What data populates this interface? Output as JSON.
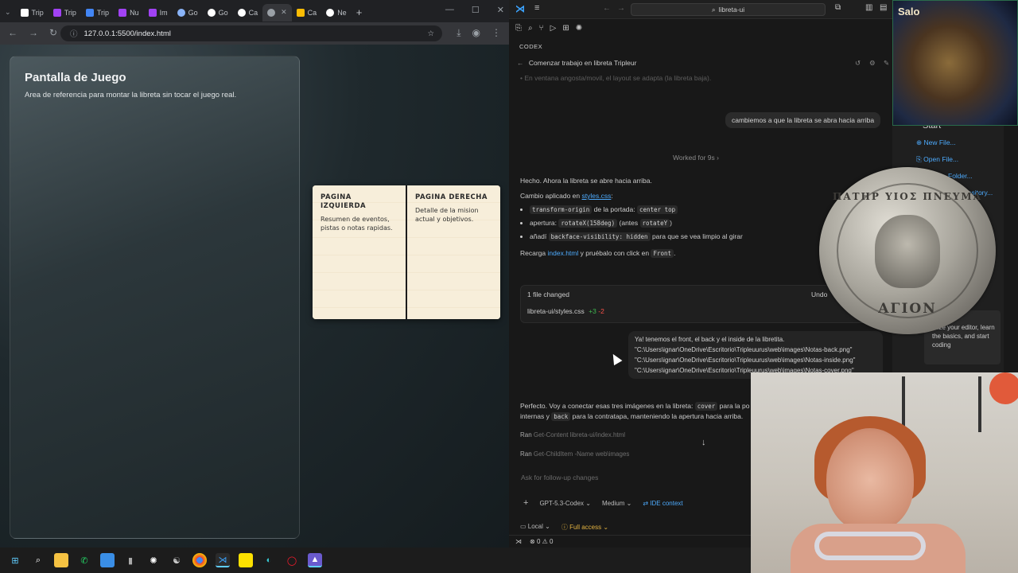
{
  "browser": {
    "tabs": [
      {
        "label": "Trip",
        "color": "#ffffff"
      },
      {
        "label": "Trip",
        "color": "#a142f4"
      },
      {
        "label": "Trip",
        "color": "#4285f4"
      },
      {
        "label": "Nu",
        "color": "#a142f4"
      },
      {
        "label": "Im",
        "color": "#a142f4"
      },
      {
        "label": "Go",
        "color": "#8ab4f8"
      },
      {
        "label": "Go",
        "color": "#ffffff"
      },
      {
        "label": "Ca",
        "color": "#ffffff"
      },
      {
        "label": "",
        "color": "#9aa0a6"
      },
      {
        "label": "Ca",
        "color": "#fbbc04"
      },
      {
        "label": "Ne",
        "color": "#ffffff"
      }
    ],
    "active_tab_index": 8,
    "url": "127.0.0.1:5500/index.html",
    "page": {
      "title": "Pantalla de Juego",
      "subtitle": "Area de referencia para montar la libreta sin tocar el juego real.",
      "left_page": {
        "heading": "PAGINA IZQUIERDA",
        "body": "Resumen de eventos, pistas o notas rapidas."
      },
      "right_page": {
        "heading": "PAGINA DERECHA",
        "body": "Detalle de la mision actual y objetivos."
      }
    }
  },
  "vscode": {
    "search_text": "libreta-ui",
    "panel_label": "CODEX",
    "thread_title": "Comenzar trabajo en libreta Tripleur",
    "faded_line": "En ventana angosta/movil, el layout se adapta (la libreta baja).",
    "user_message_1": "cambiemos a que la libreta se abra hacia arriba",
    "worked_for": "Worked for 9s",
    "reply": {
      "line1": "Hecho. Ahora la libreta se abre hacia arriba.",
      "line2_prefix": "Cambio aplicado en",
      "line2_link": "styles.css",
      "b1_code": "transform-origin",
      "b1_mid": "de la portada:",
      "b1_code2": "center top",
      "b2_prefix": "apertura:",
      "b2_code": "rotateX(158deg)",
      "b2_mid": "(antes",
      "b2_code2": "rotateY",
      "b2_end": ")",
      "b3_prefix": "añadí",
      "b3_code": "backface-visibility: hidden",
      "b3_end": "para que se vea limpio al girar",
      "line3_prefix": "Recarga",
      "line3_link": "index.html",
      "line3_mid": "y pruébalo con click en",
      "line3_code": "Front",
      "line3_end": "."
    },
    "files_changed": {
      "title": "1 file changed",
      "undo": "Undo",
      "file": "libreta-ui/styles.css",
      "added": "+3",
      "removed": "-2"
    },
    "user_message_2": {
      "line1": "Ya! tenemos el front, el back y el inside de la libretita.",
      "line2": "\"C:\\Users\\ignar\\OneDrive\\Escritorio\\Tripleuurus\\web\\images\\Notas-back.png\"",
      "line3": "\"C:\\Users\\ignar\\OneDrive\\Escritorio\\Tripleuurus\\web\\images\\Notas-inside.png\"",
      "line4": "\"C:\\Users\\ignar\\OneDrive\\Escritorio\\Tripleuurus\\web\\images\\Notas-cover.png\""
    },
    "reply2": {
      "part1": "Perfecto. Voy a conectar esas tres imágenes en la libreta:",
      "code1": "cover",
      "part2": "para la po",
      "part3": "internas y",
      "code2": "back",
      "part4": "para la contratapa, manteniendo la apertura hacia arriba."
    },
    "ran_1": {
      "prefix": "Ran",
      "cmd": "Get-Content libreta-ui/index.html"
    },
    "ran_2": {
      "prefix": "Ran",
      "cmd": "Get-ChildItem -Name web\\images"
    },
    "composer_placeholder": "Ask for follow-up changes",
    "model": "GPT-5.3-Codex",
    "effort": "Medium",
    "ide_context": "IDE context",
    "local": "Local",
    "access": "Full access",
    "status": "0 ⚠ 0"
  },
  "welcome": {
    "heading": "Start",
    "new_file": "New File...",
    "open_file": "Open File...",
    "open_folder": "Folder...",
    "clone": "pository...",
    "walkthrough": "mize your editor, learn the basics, and start coding"
  },
  "overlay": {
    "webcam_label": "Salo",
    "coin_top": "ΠΑΤΗΡ ΥΙΟΣ ΠΝΕΥΜΑ",
    "coin_bottom": "ΑΓΙΟΝ"
  }
}
